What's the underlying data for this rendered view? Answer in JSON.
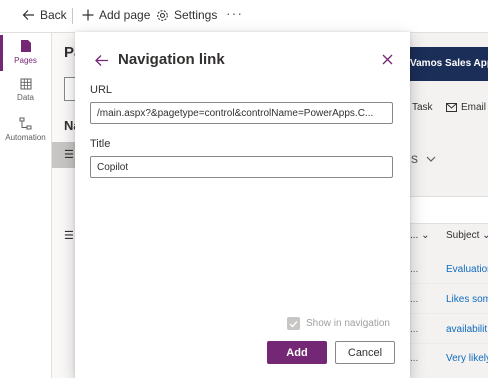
{
  "topbar": {
    "back_label": "Back",
    "add_page_label": "Add page",
    "settings_label": "Settings",
    "more_label": "···"
  },
  "rail": {
    "items": [
      {
        "label": "Pages",
        "icon": "pages-icon",
        "active": true
      },
      {
        "label": "Data",
        "icon": "table-icon",
        "active": false
      },
      {
        "label": "Automation",
        "icon": "flow-icon",
        "active": false
      }
    ]
  },
  "background": {
    "pages_heading_partial": "Pa",
    "nav_heading_partial": "Na",
    "app_title": "Vamos Sales App",
    "commands": {
      "task": "Task",
      "email": "Email"
    },
    "view_title_partial": "s",
    "columns": {
      "dots": "...",
      "subject": "Subject"
    },
    "rows": [
      {
        "dots": "...",
        "subject": "Evaluation"
      },
      {
        "dots": "...",
        "subject": "Likes som"
      },
      {
        "dots": "...",
        "subject": "availabilit"
      },
      {
        "dots": "...",
        "subject": "Very likely"
      }
    ]
  },
  "dialog": {
    "title": "Navigation link",
    "url_label": "URL",
    "url_value": "/main.aspx?&pagetype=control&controlName=PowerApps.C...",
    "title_label": "Title",
    "title_value": "Copilot",
    "show_in_nav_label": "Show in navigation",
    "show_in_nav_checked": true,
    "add_label": "Add",
    "cancel_label": "Cancel"
  },
  "colors": {
    "accent": "#742774",
    "app_header": "#1b2e58",
    "link": "#0f6cbd"
  }
}
